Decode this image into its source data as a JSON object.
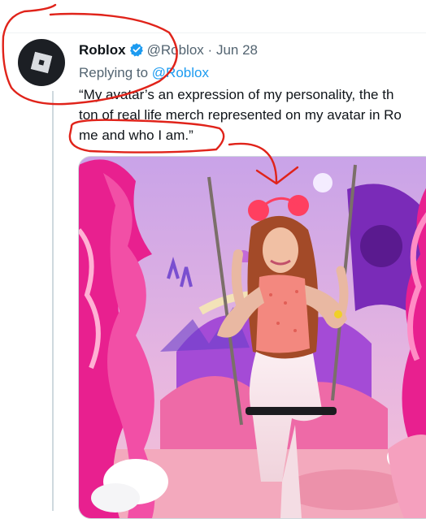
{
  "tweet": {
    "display_name": "Roblox",
    "handle": "@Roblox",
    "separator": "·",
    "date": "Jun 28",
    "reply_prefix": "Replying to",
    "reply_to": "@Roblox",
    "text_lines": [
      "“My avatar’s an expression of my personality, the th",
      "ton of real life merch represented on my avatar in Ro",
      "me and who I am.”"
    ]
  },
  "icons": {
    "avatar": "roblox-logo",
    "verified": "verified-badge"
  },
  "colors": {
    "link": "#1d9bf0",
    "secondary_text": "#536471",
    "annotation": "#e0231a",
    "verified": "#1d9bf0"
  }
}
